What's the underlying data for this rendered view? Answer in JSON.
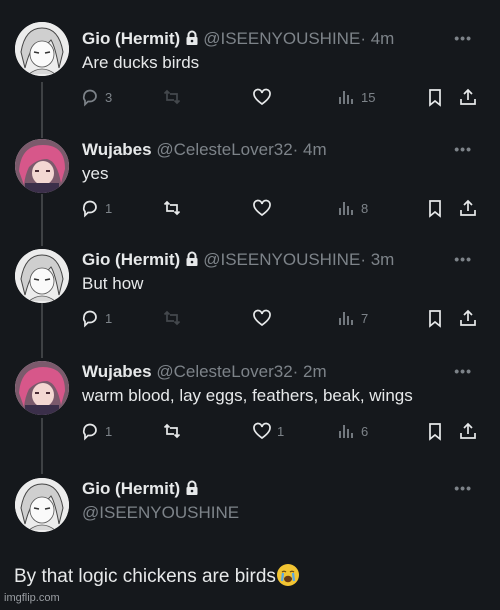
{
  "tweets": [
    {
      "name": "Gio (Hermit)",
      "locked": true,
      "handle": "@ISEENYOUSHINE",
      "time": "· 4m",
      "text": "Are ducks birds",
      "replies": "3",
      "retweets": "",
      "likes": "",
      "views": "15"
    },
    {
      "name": "Wujabes",
      "locked": false,
      "handle": "@CelesteLover32",
      "time": "· 4m",
      "text": "yes",
      "replies": "1",
      "retweets": "",
      "likes": "",
      "views": "8"
    },
    {
      "name": "Gio (Hermit)",
      "locked": true,
      "handle": "@ISEENYOUSHINE",
      "time": "· 3m",
      "text": "But how",
      "replies": "1",
      "retweets": "",
      "likes": "",
      "views": "7"
    },
    {
      "name": "Wujabes",
      "locked": false,
      "handle": "@CelesteLover32",
      "time": "· 2m",
      "text": "warm blood, lay eggs, feathers, beak, wings",
      "replies": "1",
      "retweets": "",
      "likes": "1",
      "views": "6"
    }
  ],
  "main_tweet": {
    "name": "Gio (Hermit)",
    "locked": true,
    "handle": "@ISEENYOUSHINE",
    "text": "By that logic chickens are birds",
    "emoji": "loudly-crying-face-icon"
  },
  "more_label": "•••",
  "watermark": "imgflip.com",
  "colors": {
    "background": "#15181c",
    "text": "#e7e9ea",
    "muted": "#7d8389",
    "thread_line": "#3e4144"
  }
}
